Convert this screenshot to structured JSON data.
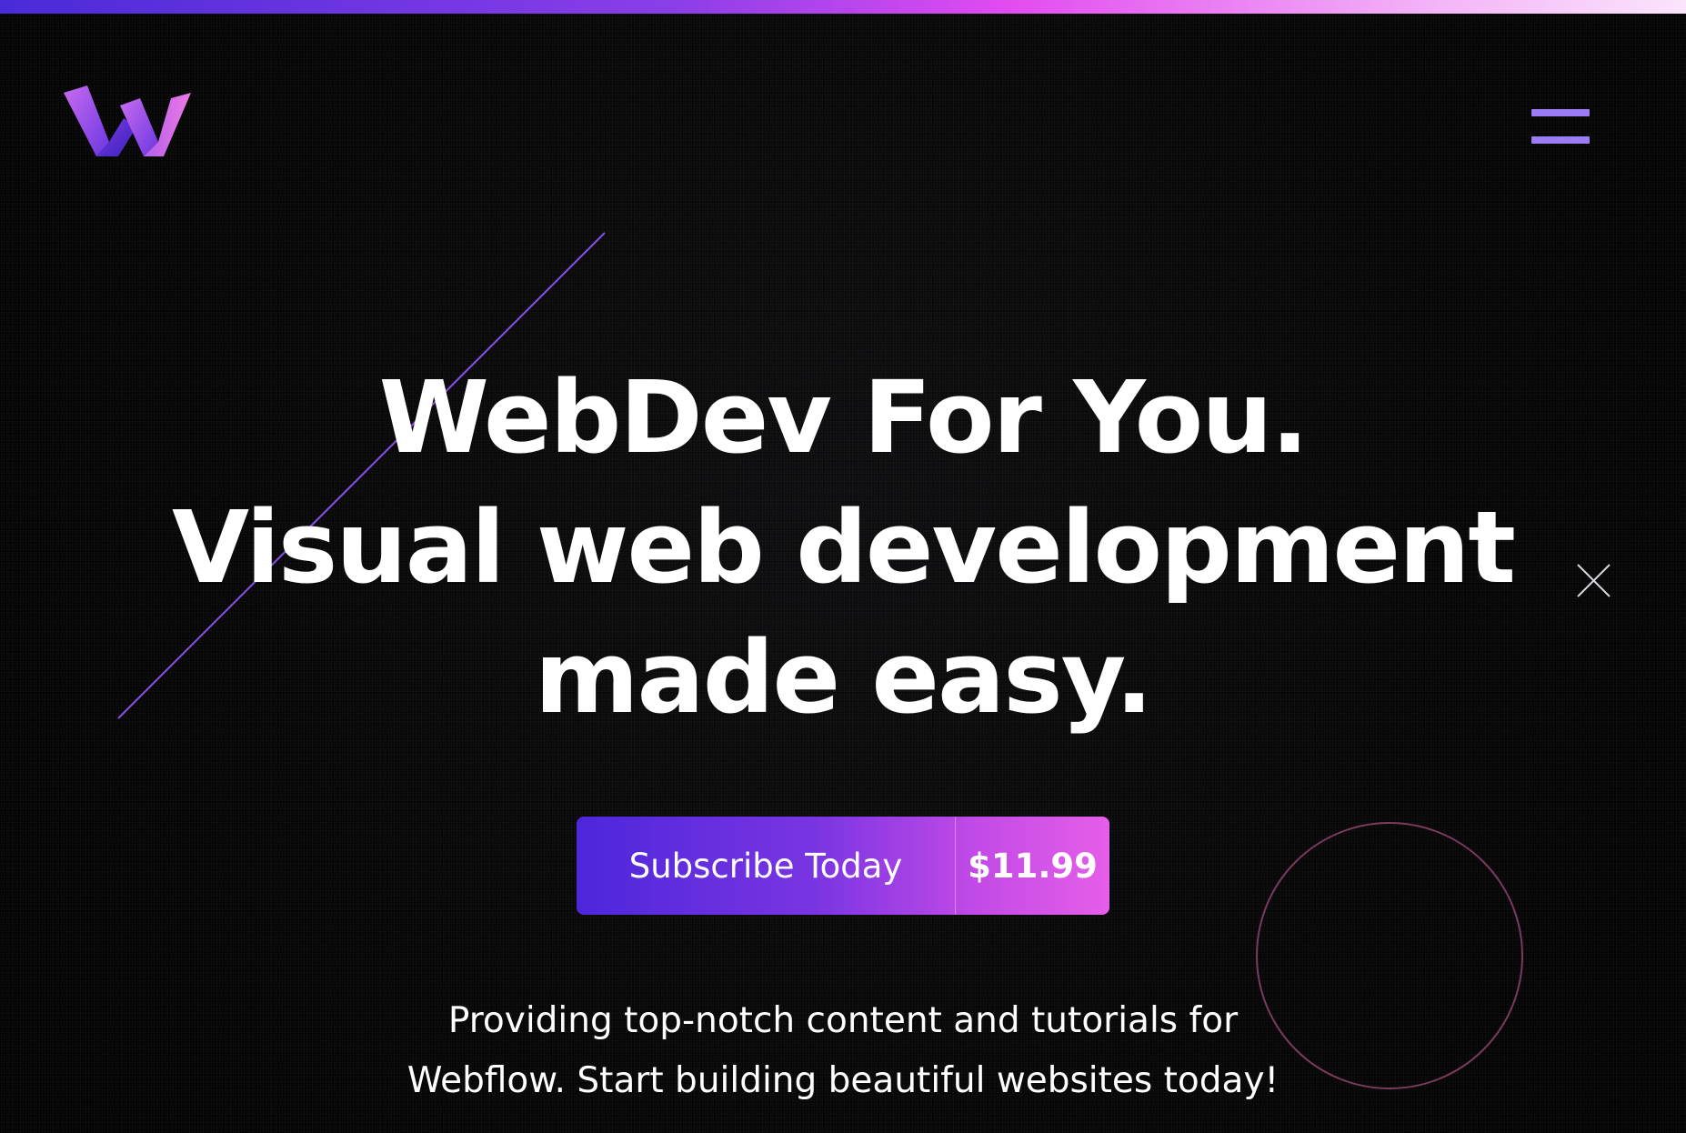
{
  "header": {
    "logo_icon": "webdev-w-logo-icon",
    "menu_icon": "hamburger-menu-icon"
  },
  "hero": {
    "title_lines": [
      "WebDev For You.",
      "Visual web development",
      "made easy."
    ],
    "cta": {
      "label": "Subscribe Today",
      "price": "$11.99"
    },
    "subtitle_lines": [
      "Providing top-notch content and tutorials for",
      "Webflow. Start building beautiful websites today!"
    ]
  },
  "colors": {
    "background": "#050505",
    "accent_purple": "#9b7cf4",
    "gradient_start": "#4d27db",
    "gradient_end": "#e65ee9",
    "text": "#ffffff"
  }
}
